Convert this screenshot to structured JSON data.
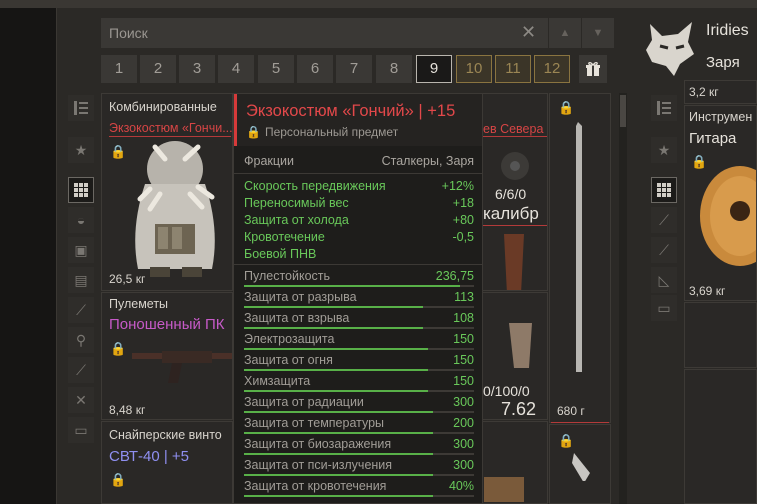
{
  "search": {
    "placeholder": "Поиск",
    "clear_icon": "✕",
    "up_icon": "▲",
    "down_icon": "▼"
  },
  "pages": {
    "items": [
      "1",
      "2",
      "3",
      "4",
      "5",
      "6",
      "7",
      "8",
      "9",
      "10",
      "11",
      "12"
    ],
    "active": "9",
    "locked": [
      "10",
      "11",
      "12"
    ],
    "gift_icon": "gift-icon"
  },
  "left_sidebar": {
    "icons": [
      "shelf-icon",
      "star-icon",
      "grid-icon",
      "helmet-icon",
      "armor-icon",
      "backpack-icon",
      "rifle-icon",
      "grenade-icon",
      "knife-icon",
      "tools-icon",
      "container-icon"
    ],
    "selected": "grid-icon"
  },
  "items": [
    {
      "category": "Комбинированные",
      "name": "Экзокостюм «Гончи...",
      "weight": "26,5 кг"
    },
    {
      "category": "Пулеметы",
      "name": "Поношенный ПК",
      "weight": "8,48 кг"
    },
    {
      "category": "Снайперские винто",
      "name": "СВТ-40 | +5"
    }
  ],
  "middle_items": {
    "top_name": "ев Севера",
    "ammo": "6/6/0",
    "caliber": "калибр",
    "ammo2": "0/100/0",
    "caliber2": "7.62"
  },
  "right_knife": {
    "weight": "680 г"
  },
  "tooltip": {
    "title": "Экзокостюм «Гончий» | +15",
    "subtitle": "Персональный предмет",
    "faction_label": "Фракции",
    "faction_value": "Сталкеры, Заря",
    "bonuses": [
      {
        "label": "Скорость передвижения",
        "value": "+12%"
      },
      {
        "label": "Переносимый вес",
        "value": "+18"
      },
      {
        "label": "Защита от холода",
        "value": "+80"
      },
      {
        "label": "Кровотечение",
        "value": "-0,5"
      },
      {
        "label": "Боевой ПНВ",
        "value": ""
      }
    ],
    "protections": [
      {
        "label": "Пулестойкость",
        "value": "236,75",
        "fill": 0.94
      },
      {
        "label": "Защита от разрыва",
        "value": "113",
        "fill": 0.78
      },
      {
        "label": "Защита от взрыва",
        "value": "108",
        "fill": 0.78
      },
      {
        "label": "Электрозащита",
        "value": "150",
        "fill": 0.8
      },
      {
        "label": "Защита от огня",
        "value": "150",
        "fill": 0.8
      },
      {
        "label": "Химзащита",
        "value": "150",
        "fill": 0.8
      },
      {
        "label": "Защита от радиации",
        "value": "300",
        "fill": 0.82
      },
      {
        "label": "Защита от температуры",
        "value": "200",
        "fill": 0.82
      },
      {
        "label": "Защита от биозаражения",
        "value": "300",
        "fill": 0.82
      },
      {
        "label": "Защита от пси-излучения",
        "value": "300",
        "fill": 0.82
      },
      {
        "label": "Защита от кровотечения",
        "value": "40%",
        "fill": 0.82
      }
    ]
  },
  "right_panel": {
    "username": "Iridies",
    "faction": "Заря",
    "partial_weight": "3,2 кг",
    "item_category": "Инструмен",
    "item_name": "Гитара",
    "item_weight": "3,69 кг"
  }
}
